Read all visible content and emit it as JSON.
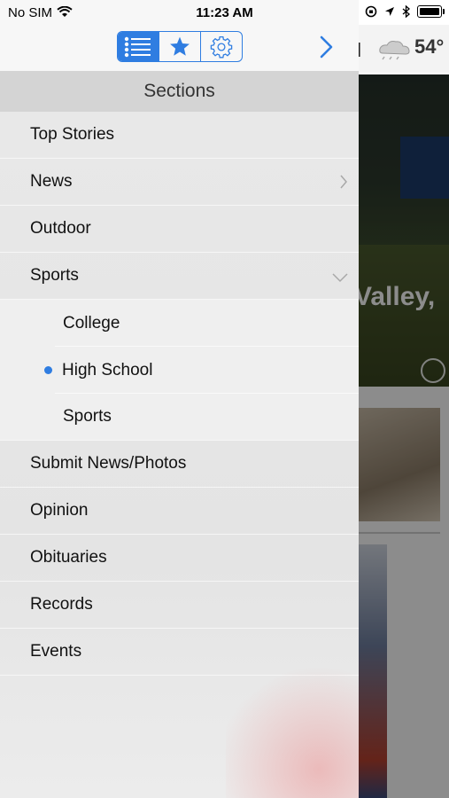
{
  "status_bar": {
    "carrier": "No SIM",
    "time": "11:23 AM"
  },
  "background": {
    "weather_temp": "54°",
    "hero_text": "Valley,",
    "cut_char": "l"
  },
  "toolbar": {
    "segments": [
      {
        "name": "sections",
        "icon": "list-icon",
        "active": true
      },
      {
        "name": "favorites",
        "icon": "star-icon",
        "active": false
      },
      {
        "name": "settings",
        "icon": "gear-icon",
        "active": false
      }
    ],
    "accent": "#2f7de1"
  },
  "sections": {
    "header": "Sections",
    "items": [
      {
        "label": "Top Stories"
      },
      {
        "label": "News"
      },
      {
        "label": "Outdoor"
      },
      {
        "label": "Sports"
      },
      {
        "label": "College"
      },
      {
        "label": "High School"
      },
      {
        "label": "Sports"
      },
      {
        "label": "Submit News/Photos"
      },
      {
        "label": "Opinion"
      },
      {
        "label": "Obituaries"
      },
      {
        "label": "Records"
      },
      {
        "label": "Events"
      }
    ]
  }
}
